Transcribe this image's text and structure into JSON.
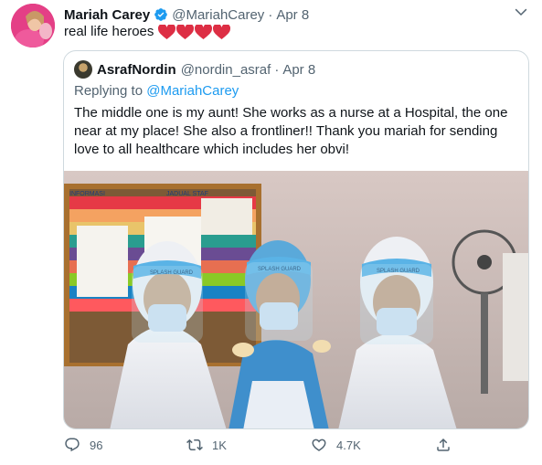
{
  "tweet": {
    "author_name": "Mariah Carey",
    "author_handle": "@MariahCarey",
    "separator": "·",
    "time": "Apr 8",
    "text": "real life heroes",
    "heart_count_emojis": 4
  },
  "quoted": {
    "author_name": "AsrafNordin",
    "author_handle": "@nordin_asraf",
    "separator": "·",
    "time": "Apr 8",
    "replying_prefix": "Replying to",
    "replying_to": "@MariahCarey",
    "text": "The middle one is my aunt! She works as a nurse at a Hospital, the one near at my place! She also a frontliner!! Thank you mariah for sending love to all healthcare which includes her obvi!",
    "photo": {
      "board_label_left": "INFORMASI",
      "board_label_right": "JADUAL STAF",
      "visor_left": "SPLASH GUARD",
      "visor_middle": "SPLASH GUARD",
      "visor_right": "SPLASH GUARD"
    }
  },
  "actions": {
    "reply_count": "96",
    "retweet_count": "1K",
    "like_count": "4.7K"
  },
  "colors": {
    "accent": "#1d9bf0",
    "secondary_text": "#536471",
    "heart": "#e0245e"
  }
}
